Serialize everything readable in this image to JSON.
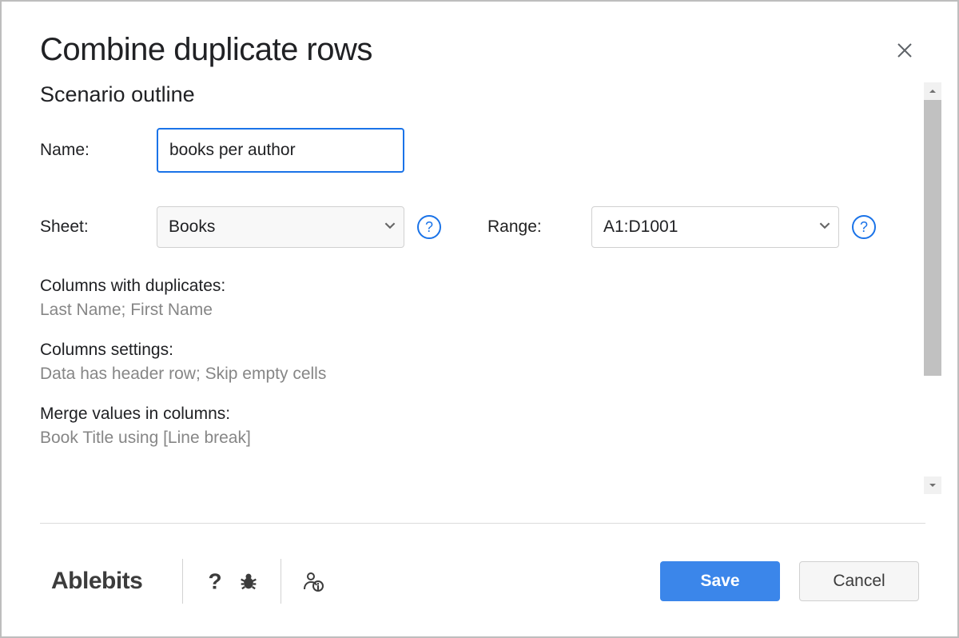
{
  "dialog": {
    "title": "Combine duplicate rows"
  },
  "section": {
    "title": "Scenario outline"
  },
  "fields": {
    "name_label": "Name:",
    "name_value": "books per author",
    "sheet_label": "Sheet:",
    "sheet_value": "Books",
    "range_label": "Range:",
    "range_value": "A1:D1001"
  },
  "info": {
    "dup_cols_label": "Columns with duplicates:",
    "dup_cols_value": "Last Name; First Name",
    "cols_settings_label": "Columns settings:",
    "cols_settings_value": "Data has header row; Skip empty cells",
    "merge_label": "Merge values in columns:",
    "merge_value": "Book Title using [Line break]"
  },
  "footer": {
    "brand": "Ablebits",
    "save_label": "Save",
    "cancel_label": "Cancel"
  },
  "glyphs": {
    "help": "?"
  }
}
